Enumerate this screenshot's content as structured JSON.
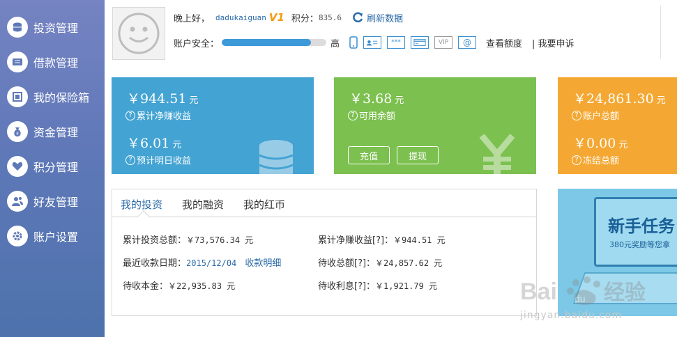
{
  "sidebar": {
    "items": [
      {
        "label": "投资管理",
        "icon": "coins-icon"
      },
      {
        "label": "借款管理",
        "icon": "loan-icon"
      },
      {
        "label": "我的保险箱",
        "icon": "safe-icon"
      },
      {
        "label": "资金管理",
        "icon": "money-bag-icon"
      },
      {
        "label": "积分管理",
        "icon": "heart-icon"
      },
      {
        "label": "好友管理",
        "icon": "friends-icon"
      },
      {
        "label": "账户设置",
        "icon": "gear-icon"
      }
    ]
  },
  "user": {
    "greeting": "晚上好，",
    "username": "dadukaiguan",
    "vip_badge": "V1",
    "points_label": "积分：",
    "points_value": "835.6",
    "refresh_label": "刷新数据",
    "security_label": "账户安全：",
    "security_level": "高",
    "security_progress": 0.85,
    "verify": [
      "phone",
      "id-card",
      "***",
      "bank-card",
      "VIP",
      "@"
    ],
    "check_quota": "查看额度",
    "complain": "| 我要申诉"
  },
  "cards": {
    "blue": {
      "amount1": "￥944.51",
      "unit": "元",
      "caption1": "累计净赚收益",
      "amount2": "￥6.01",
      "caption2": "预计明日收益"
    },
    "green": {
      "amount1": "￥3.68",
      "unit": "元",
      "caption1": "可用余额",
      "recharge": "充值",
      "withdraw": "提现"
    },
    "orange": {
      "amount1": "￥24,861.30",
      "unit": "元",
      "caption1": "账户总额",
      "amount2": "￥0.00",
      "caption2": "冻结总额"
    },
    "help": "?"
  },
  "invest": {
    "tabs": [
      "我的投资",
      "我的融资",
      "我的红币"
    ],
    "rows": [
      {
        "label": "累计投资总额：",
        "value": "￥73,576.34 元"
      },
      {
        "label": "累计净赚收益[?]：",
        "value": "￥944.51 元"
      },
      {
        "label": "最近收款日期：",
        "value": "2015/12/04",
        "link": "收款明细"
      },
      {
        "label": "待收总额[?]：",
        "value": "￥24,857.62 元"
      },
      {
        "label": "待收本金：",
        "value": "￥22,935.83 元"
      },
      {
        "label": "待收利息[?]：",
        "value": "￥1,921.79 元"
      }
    ]
  },
  "promo": {
    "title": "新手任务",
    "subtitle": "380元奖励等您拿"
  },
  "watermark": {
    "brand": "Bai du 经验",
    "url": "jingyan.baidu.com"
  },
  "colors": {
    "sidebar": "#5f78b8",
    "blue_card": "#43a3d3",
    "green_card": "#7cc04f",
    "orange_card": "#f4a833",
    "link": "#2a6aa8",
    "promo": "#7cc8e6"
  }
}
